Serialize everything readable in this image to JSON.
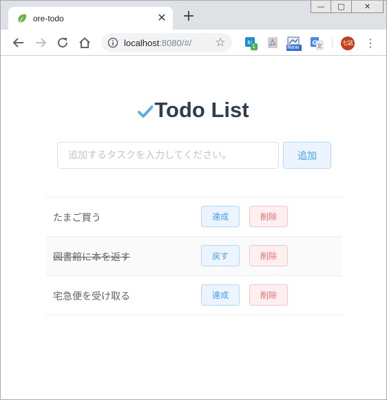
{
  "browser": {
    "tab_title": "ore-todo",
    "tab_close": "✕",
    "new_tab": "+",
    "window_controls": {
      "minimize": "—",
      "maximize": "□",
      "close": "✕"
    },
    "url_host": "localhost",
    "url_rest": ":8080/#/",
    "star": "☆",
    "extensions": [
      {
        "name": "bookmark-ext-icon",
        "badge": "1"
      },
      {
        "name": "pdf-ext-icon"
      },
      {
        "name": "new-ext-icon",
        "badge": "New"
      },
      {
        "name": "translate-ext-icon"
      }
    ],
    "avatar_text": "七誌",
    "menu": "⋮"
  },
  "app": {
    "title": "Todo List",
    "input_placeholder": "追加するタスクを入力してください。",
    "input_value": "",
    "add_label": "追加",
    "todos": [
      {
        "text": "たまご買う",
        "done": false,
        "toggle_label": "達成",
        "delete_label": "削除"
      },
      {
        "text": "図書館に本を返す",
        "done": true,
        "toggle_label": "戻す",
        "delete_label": "削除"
      },
      {
        "text": "宅急便を受け取る",
        "done": false,
        "toggle_label": "達成",
        "delete_label": "削除"
      }
    ]
  },
  "colors": {
    "accent": "#409eff",
    "danger": "#f56c6c",
    "title": "#2c3e50",
    "check": "#5dade2"
  }
}
